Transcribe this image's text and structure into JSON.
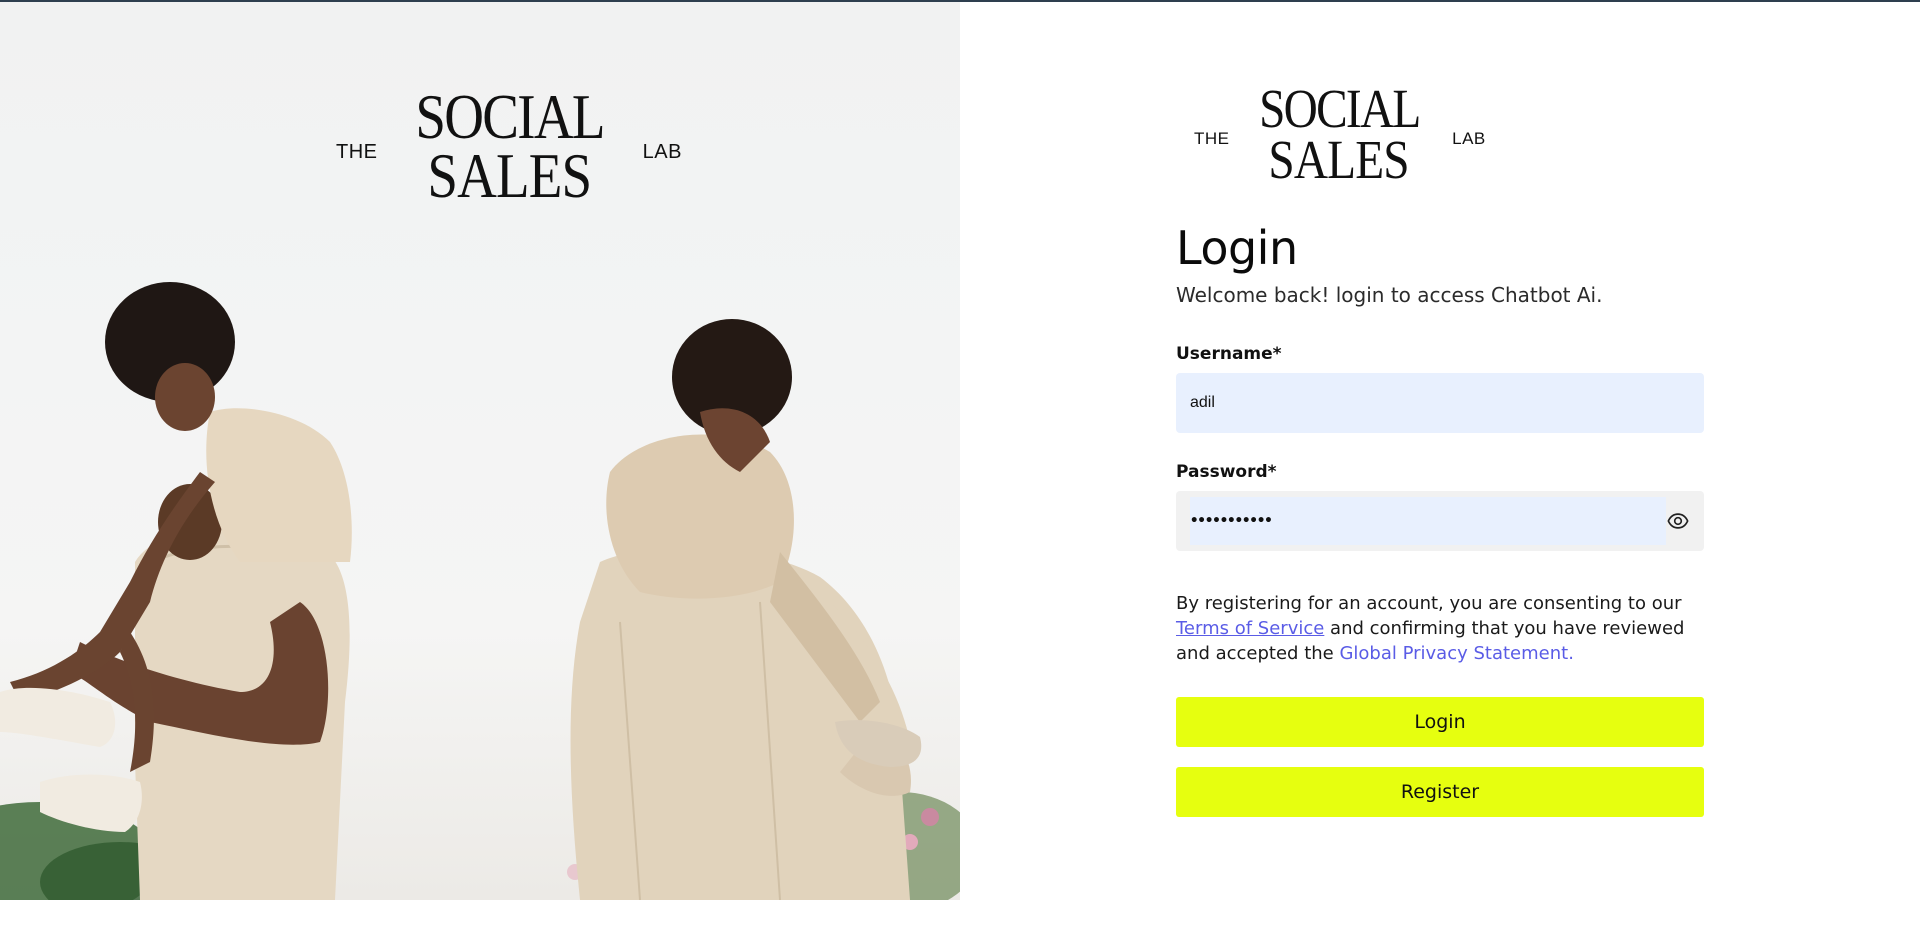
{
  "brand": {
    "prefix": "THE",
    "line1": "SOCIAL",
    "line2": "SALES",
    "suffix": "LAB"
  },
  "login": {
    "title": "Login",
    "subtitle": "Welcome back! login to access Chatbot Ai.",
    "username_label": "Username*",
    "username_value": "adil",
    "password_label": "Password*",
    "password_masked": "•••••••••••",
    "consent_prefix": "By registering for an account, you are consenting to our ",
    "terms_link": "Terms of Service",
    "consent_middle": " and confirming that you have reviewed and accepted the ",
    "privacy_link": "Global Privacy Statement.",
    "login_button": "Login",
    "register_button": "Register"
  },
  "icons": {
    "password_toggle": "eye-icon"
  },
  "colors": {
    "button_bg": "#e6ff0f",
    "input_bg": "#e8f0fe",
    "link": "#5a5ce6",
    "top_border": "#2e3f4f"
  }
}
